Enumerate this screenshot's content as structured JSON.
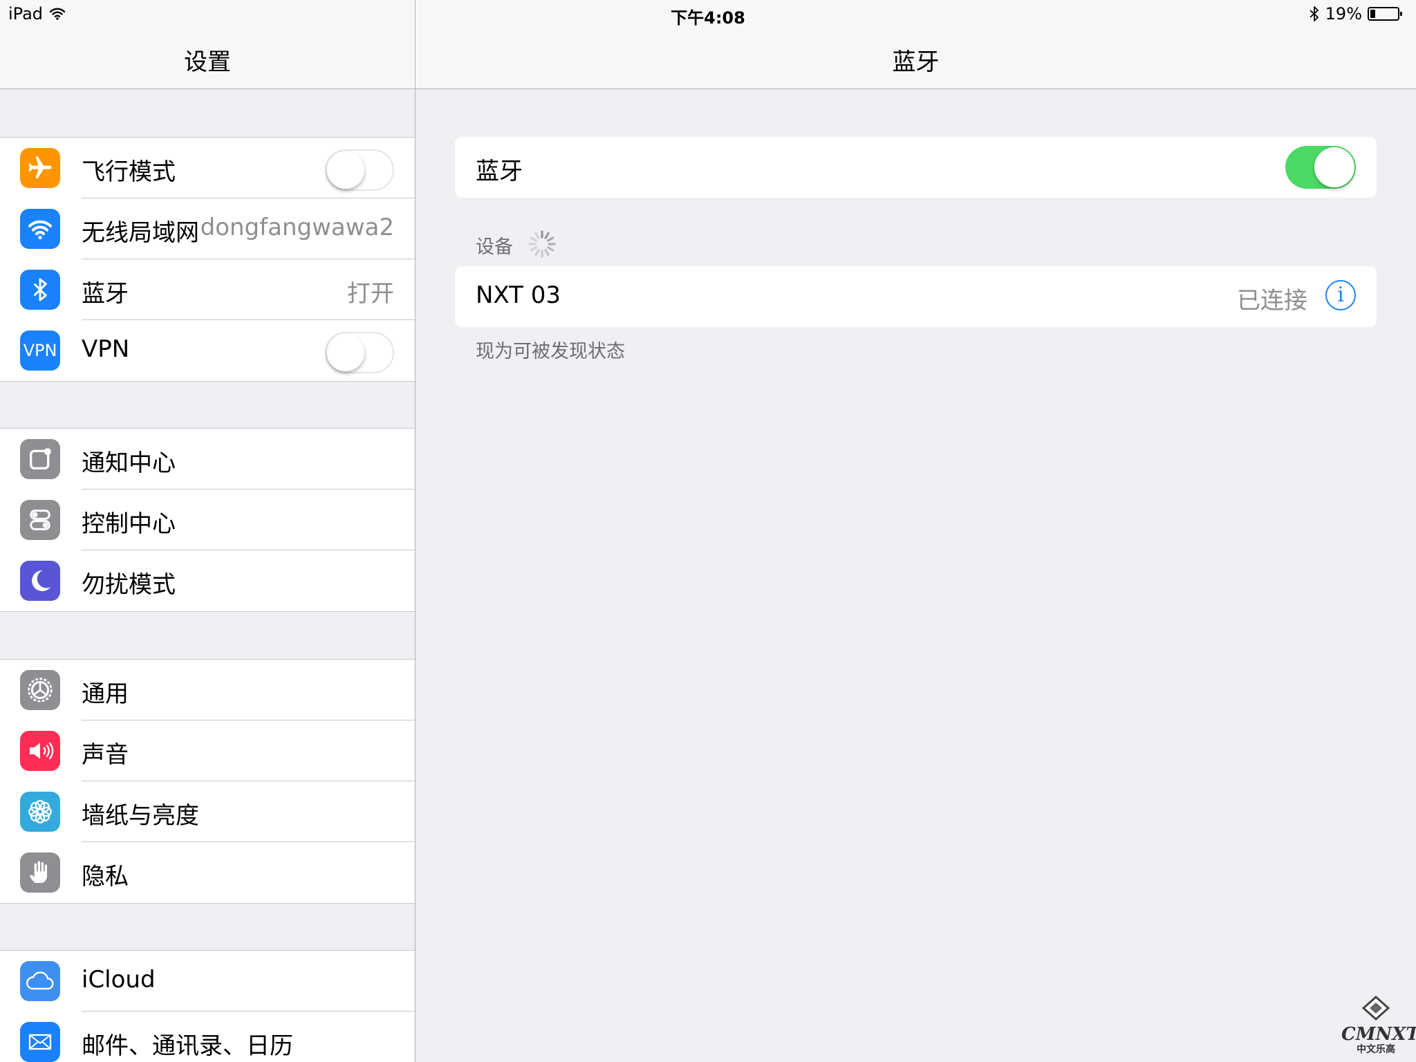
{
  "status_bar": {
    "device": "iPad",
    "time": "下午4:08",
    "battery_text": "19%",
    "battery_level": 0.19
  },
  "master": {
    "title": "设置",
    "groups": [
      [
        {
          "label": "飞行模式",
          "icon": "airplane-icon",
          "color": "#ff9500",
          "toggle": false
        },
        {
          "label": "无线局域网",
          "icon": "wifi-icon",
          "color": "#1a82fb",
          "value": "dongfangwawa2"
        },
        {
          "label": "蓝牙",
          "icon": "bluetooth-icon",
          "color": "#1a82fb",
          "value": "打开"
        },
        {
          "label": "VPN",
          "icon": "vpn-icon",
          "icon_text": "VPN",
          "color": "#1a82fb",
          "toggle": false
        }
      ],
      [
        {
          "label": "通知中心",
          "icon": "notification-center-icon",
          "color": "#8e8e93"
        },
        {
          "label": "控制中心",
          "icon": "control-center-icon",
          "color": "#8e8e93"
        },
        {
          "label": "勿扰模式",
          "icon": "moon-icon",
          "color": "#5856d6"
        }
      ],
      [
        {
          "label": "通用",
          "icon": "gear-icon",
          "color": "#8e8e93"
        },
        {
          "label": "声音",
          "icon": "speaker-icon",
          "color": "#ff2d55"
        },
        {
          "label": "墙纸与亮度",
          "icon": "flower-icon",
          "color": "#34aadc"
        },
        {
          "label": "隐私",
          "icon": "hand-icon",
          "color": "#8e8e93"
        }
      ],
      [
        {
          "label": "iCloud",
          "icon": "cloud-icon",
          "color": "#3e8ff0"
        },
        {
          "label": "邮件、通讯录、日历",
          "icon": "mail-icon",
          "color": "#1a82fb"
        }
      ]
    ]
  },
  "detail": {
    "title": "蓝牙",
    "bluetooth_toggle": {
      "label": "蓝牙",
      "on": true,
      "color": "#4cd964"
    },
    "devices_header": "设备",
    "device": {
      "name": "NXT 03",
      "status": "已连接",
      "info_glyph": "i"
    },
    "footer": "现为可被发现状态"
  },
  "watermark": {
    "text": "CMNXT",
    "subtext": "中文乐高"
  }
}
